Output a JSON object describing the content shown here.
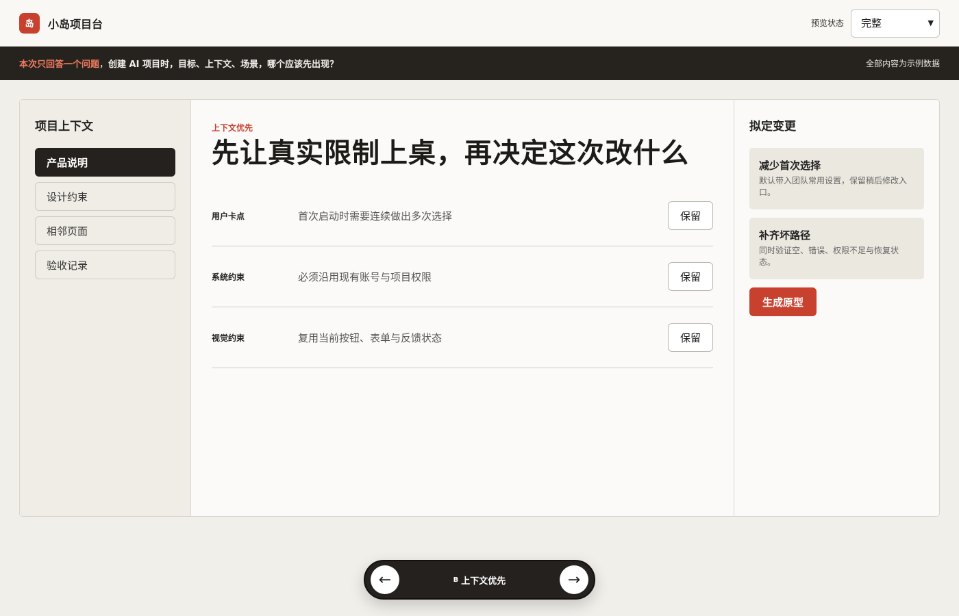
{
  "header": {
    "logo_glyph": "岛",
    "app_name": "小岛项目台",
    "preview_label": "预览状态",
    "preview_value": "完整"
  },
  "notice": {
    "highlight": "本次只回答一个问题",
    "separator": "，",
    "question": "创建 AI 项目时，目标、上下文、场景，哪个应该先出现？",
    "right": "全部内容为示例数据"
  },
  "sidebar": {
    "title": "项目上下文",
    "items": [
      {
        "label": "产品说明"
      },
      {
        "label": "设计约束"
      },
      {
        "label": "相邻页面"
      },
      {
        "label": "验收记录"
      }
    ]
  },
  "main": {
    "eyebrow": "上下文优先",
    "headline": "先让真实限制上桌，再决定这次改什么",
    "rows": [
      {
        "label": "用户卡点",
        "text": "首次启动时需要连续做出多次选择",
        "button": "保留"
      },
      {
        "label": "系统约束",
        "text": "必须沿用现有账号与项目权限",
        "button": "保留"
      },
      {
        "label": "视觉约束",
        "text": "复用当前按钮、表单与反馈状态",
        "button": "保留"
      }
    ]
  },
  "changes": {
    "title": "拟定变更",
    "items": [
      {
        "title": "减少首次选择",
        "desc": "默认带入团队常用设置，保留稍后修改入口。"
      },
      {
        "title": "补齐坏路径",
        "desc": "同时验证空、错误、权限不足与恢复状态。"
      }
    ],
    "generate_label": "生成原型"
  },
  "pager": {
    "badge": "B",
    "label": "上下文优先",
    "prev_icon": "←",
    "next_icon": "→"
  },
  "colors": {
    "accent": "#c8412e",
    "dark": "#24211e",
    "background": "#f1efea"
  }
}
